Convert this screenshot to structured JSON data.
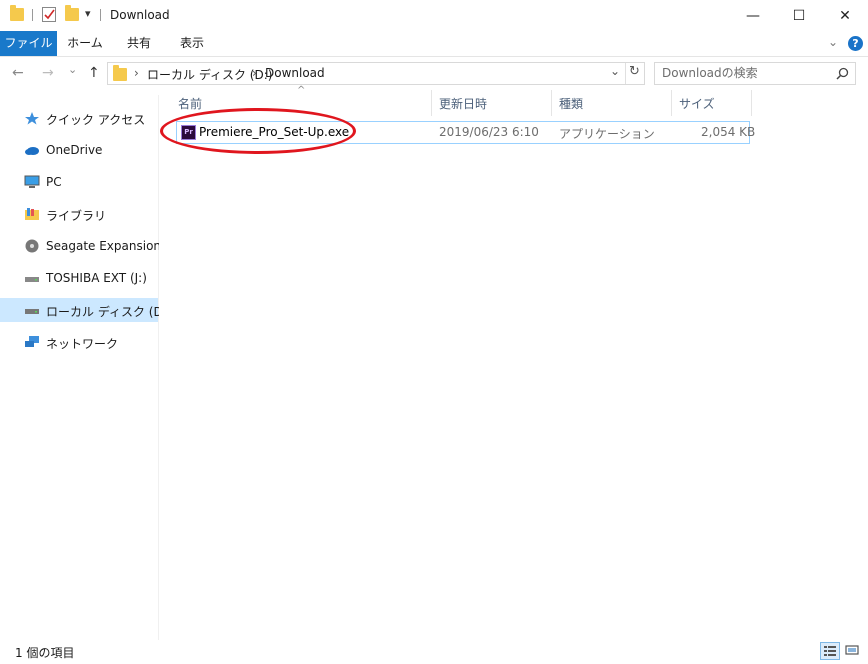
{
  "window": {
    "title": "Download",
    "qat_dropdown": "▾",
    "minimize": "—",
    "maximize": "☐",
    "close": "✕"
  },
  "ribbon": {
    "tabs": [
      {
        "label": "ファイル",
        "active": true
      },
      {
        "label": "ホーム",
        "active": false
      },
      {
        "label": "共有",
        "active": false
      },
      {
        "label": "表示",
        "active": false
      }
    ],
    "chevron": "⌄",
    "help": "?"
  },
  "nav": {
    "back": "←",
    "forward": "→",
    "recent": "⌄",
    "up": "↑"
  },
  "address": {
    "segments": [
      "ローカル ディスク (D:)",
      "Download"
    ],
    "separator": "›",
    "dropdown": "⌄",
    "refresh": "↻"
  },
  "search": {
    "placeholder": "Downloadの検索",
    "icon": "search-icon"
  },
  "sidebar": {
    "items": [
      {
        "label": "クイック アクセス",
        "icon": "star-pin-icon"
      },
      {
        "label": "OneDrive",
        "icon": "cloud-icon"
      },
      {
        "label": "PC",
        "icon": "monitor-icon"
      },
      {
        "label": "ライブラリ",
        "icon": "library-folder-icon"
      },
      {
        "label": "Seagate Expansion Dr",
        "icon": "disc-drive-icon"
      },
      {
        "label": "TOSHIBA EXT (J:)",
        "icon": "usb-drive-icon"
      },
      {
        "label": "ローカル ディスク (D:)",
        "icon": "local-disk-icon",
        "selected": true
      },
      {
        "label": "ネットワーク",
        "icon": "network-icon"
      }
    ]
  },
  "list": {
    "columns": [
      "名前",
      "更新日時",
      "種類",
      "サイズ"
    ],
    "sort_indicator": "^",
    "rows": [
      {
        "name": "Premiere_Pro_Set-Up.exe",
        "modified": "2019/06/23 6:10",
        "type": "アプリケーション",
        "size": "2,054 KB",
        "icon_label": "Pr"
      }
    ]
  },
  "status": {
    "item_count": "1 個の項目"
  },
  "colors": {
    "accent": "#1979ca",
    "selected_bg": "#cce8ff",
    "annotation_red": "#e0161e",
    "folder_yellow": "#f5c94c"
  }
}
